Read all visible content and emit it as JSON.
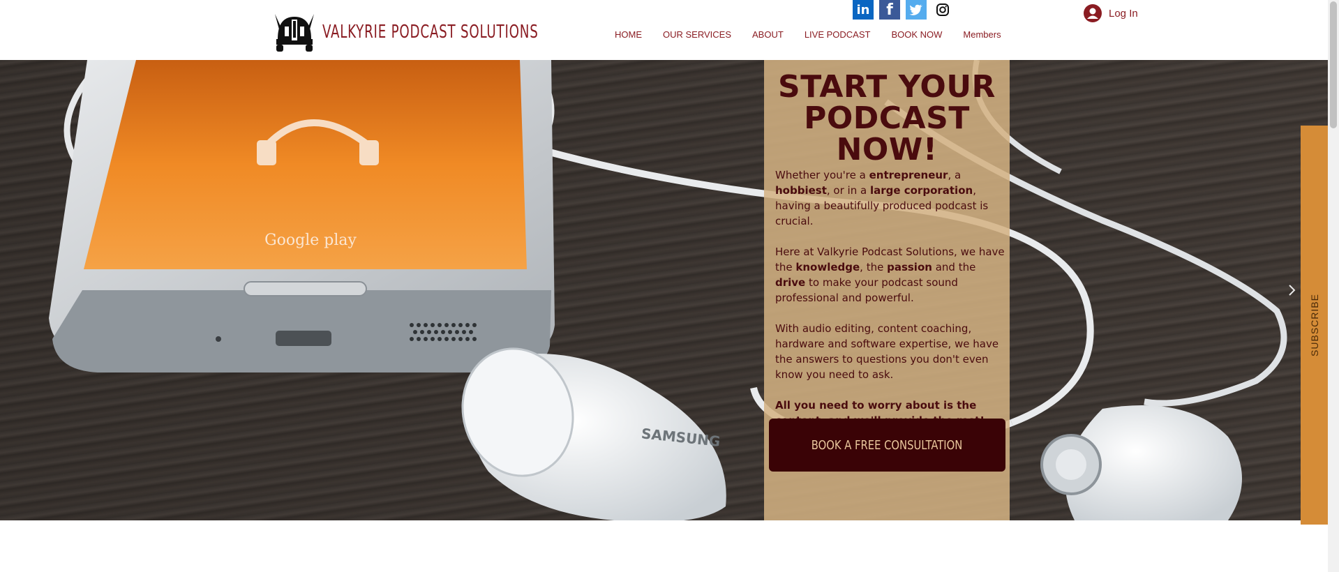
{
  "header": {
    "brand": "VALKYRIE PODCAST SOLUTIONS",
    "nav": [
      "HOME",
      "OUR SERVICES",
      "ABOUT",
      "LIVE PODCAST",
      "BOOK NOW",
      "Members"
    ],
    "login": "Log In",
    "social": [
      "linkedin-icon",
      "facebook-icon",
      "twitter-icon",
      "instagram-icon"
    ]
  },
  "hero": {
    "phone_brand": "Google play",
    "earbud_brand": "SAMSUNG",
    "title_lines": [
      "START YOUR",
      "PODCAST",
      "NOW!"
    ],
    "p1": {
      "t1": "Whether you're a ",
      "b1": "entrepreneur",
      "t2": ", a ",
      "b2": "hobbiest",
      "t3": ", or in a ",
      "b3": "large corporation",
      "t4": ", having a beautifully produced podcast is crucial."
    },
    "p2": {
      "t1": "Here at Valkyrie Podcast Solutions, we have the ",
      "b1": "knowledge",
      "t2": ", the ",
      "b2": "passion",
      "t3": " and the ",
      "b3": "drive",
      "t4": " to make your podcast sound professional and powerful."
    },
    "p3": "With audio editing, content coaching, hardware and software expertise, we have the answers to questions you don't even know you need to ask.",
    "p4": "All you need to worry about is the content, and we'll provide the rest!",
    "cta": "BOOK A FREE CONSULTATION",
    "subscribe": "SUBSCRIBE"
  },
  "colors": {
    "brand": "#8a1c22",
    "panel": "#d4b282",
    "title": "#4a0b0e",
    "cta_bg": "#3a0306",
    "cta_text": "#e9c79c",
    "subscribe_tab": "#d58c37"
  }
}
